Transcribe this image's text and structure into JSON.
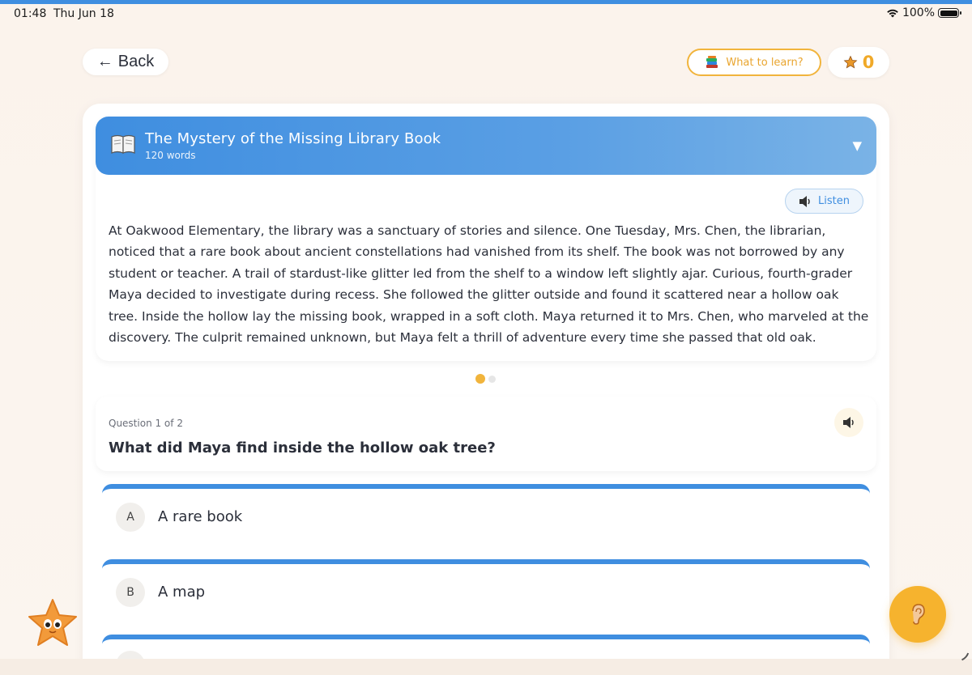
{
  "status_bar": {
    "time": "01:48",
    "date": "Thu Jun 18",
    "battery": "100%"
  },
  "header": {
    "back_label": "Back",
    "back_arrow": "←",
    "learn_label": "What to learn?",
    "star_count": "0"
  },
  "story": {
    "title": "The Mystery of the Missing Library Book",
    "word_count": "120 words",
    "listen_label": "Listen",
    "text": "At Oakwood Elementary, the library was a sanctuary of stories and silence. One Tuesday, Mrs. Chen, the librarian, noticed that a rare book about ancient constellations had vanished from its shelf. The book was not borrowed by any student or teacher. A trail of stardust-like glitter led from the shelf to a window left slightly ajar. Curious, fourth-grader Maya decided to investigate during recess. She followed the glitter outside and found it scattered near a hollow oak tree. Inside the hollow lay the missing book, wrapped in a soft cloth. Maya returned it to Mrs. Chen, who marveled at the discovery. The culprit remained unknown, but Maya felt a thrill of adventure every time she passed that old oak."
  },
  "question": {
    "number_label": "Question 1 of 2",
    "text": "What did Maya find inside the hollow oak tree?",
    "options": [
      {
        "letter": "A",
        "label": "A rare book"
      },
      {
        "letter": "B",
        "label": "A map"
      }
    ]
  },
  "colors": {
    "accent_blue": "#3f8ee0",
    "accent_orange": "#f6b32e"
  }
}
